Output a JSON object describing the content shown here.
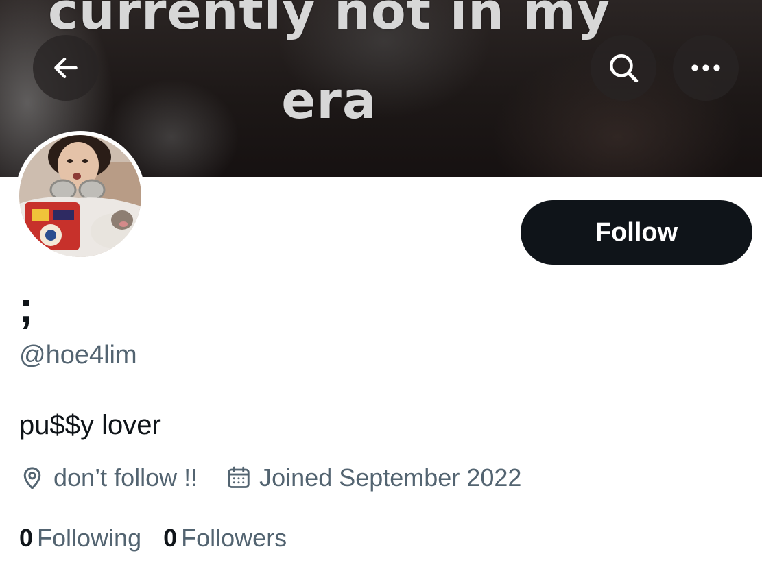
{
  "banner": {
    "caption_line1": "currently not in my",
    "caption_line2": "era"
  },
  "toolbar": {
    "back_icon": "arrow-left-icon",
    "search_icon": "search-icon",
    "more_icon": "more-horizontal-icon"
  },
  "profile": {
    "display_name": ";",
    "handle": "@hoe4lim",
    "bio": "pu$$y lover",
    "location": "don’t follow !!",
    "joined": "Joined September 2022",
    "following_count": "0",
    "following_label": "Following",
    "followers_count": "0",
    "followers_label": "Followers"
  },
  "actions": {
    "follow_label": "Follow"
  },
  "colors": {
    "primary_text": "#0f1419",
    "secondary_text": "#536471",
    "follow_button_bg": "#0f1419"
  }
}
